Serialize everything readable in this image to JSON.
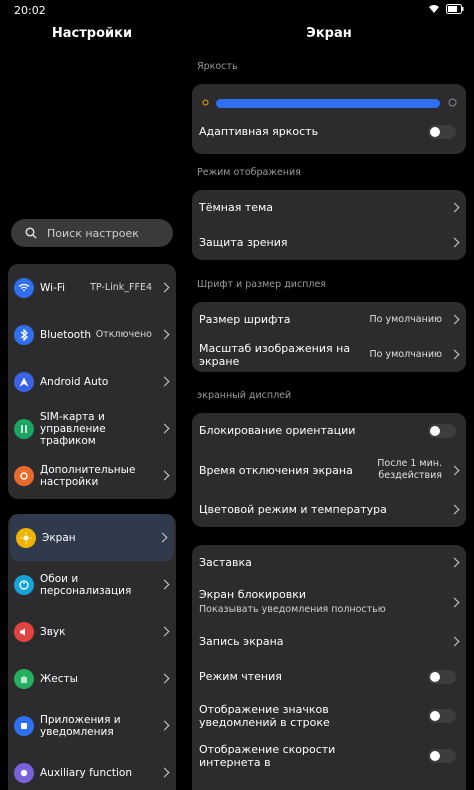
{
  "status": {
    "time": "20:02"
  },
  "left": {
    "title": "Настройки",
    "search_placeholder": "Поиск настроек",
    "group1": [
      {
        "label": "Wi-Fi",
        "value": "TP-Link_FFE4",
        "icon": "wifi-icon",
        "color": "#2f6ff2"
      },
      {
        "label": "Bluetooth",
        "value": "Отключено",
        "icon": "bluetooth-icon",
        "color": "#2f6ff2"
      },
      {
        "label": "Android Auto",
        "value": "",
        "icon": "android-auto-icon",
        "color": "#3a63e8"
      },
      {
        "label": "SIM-карта и управление трафиком",
        "value": "",
        "icon": "sim-icon",
        "color": "#1aa564"
      },
      {
        "label": "Дополнительные настройки",
        "value": "",
        "icon": "more-settings-icon",
        "color": "#e86a2a"
      }
    ],
    "group2": [
      {
        "label": "Экран",
        "icon": "sun-icon",
        "color": "#f0b400"
      },
      {
        "label": "Обои и персонализация",
        "icon": "palette-icon",
        "color": "#18a3d6"
      },
      {
        "label": "Звук",
        "icon": "sound-icon",
        "color": "#e2443f"
      },
      {
        "label": "Жесты",
        "icon": "hand-icon",
        "color": "#25b05f"
      },
      {
        "label": "Приложения и уведомления",
        "icon": "apps-icon",
        "color": "#2f6ff2"
      },
      {
        "label": "Auxiliary function",
        "icon": "auxiliary-icon",
        "color": "#7b61d9"
      }
    ]
  },
  "right": {
    "title": "Экран",
    "sections": {
      "brightness": "Яркость",
      "display_mode": "Режим отображения",
      "font": "Шрифт и размер дисплея",
      "screen": "экранный дисплей"
    },
    "adaptive": "Адаптивная яркость",
    "dark_theme": "Тёмная тема",
    "eye_protection": "Защита зрения",
    "font_size": "Размер шрифта",
    "font_size_value": "По умолчанию",
    "scale": "Масштаб изображения на экране",
    "scale_value": "По умолчанию",
    "orientation_lock": "Блокирование ориентации",
    "screen_timeout": "Время отключения экрана",
    "screen_timeout_value": "После 1 мин. бездействия",
    "color_mode": "Цветовой режим и температура",
    "screensaver": "Заставка",
    "lock_screen": "Экран блокировки",
    "lock_screen_sub": "Показывать уведомления полностью",
    "screen_record": "Запись экрана",
    "reading_mode": "Режим чтения",
    "notif_icons": "Отображение значков уведомлений в строке",
    "net_speed": "Отображение скорости интернета в"
  }
}
